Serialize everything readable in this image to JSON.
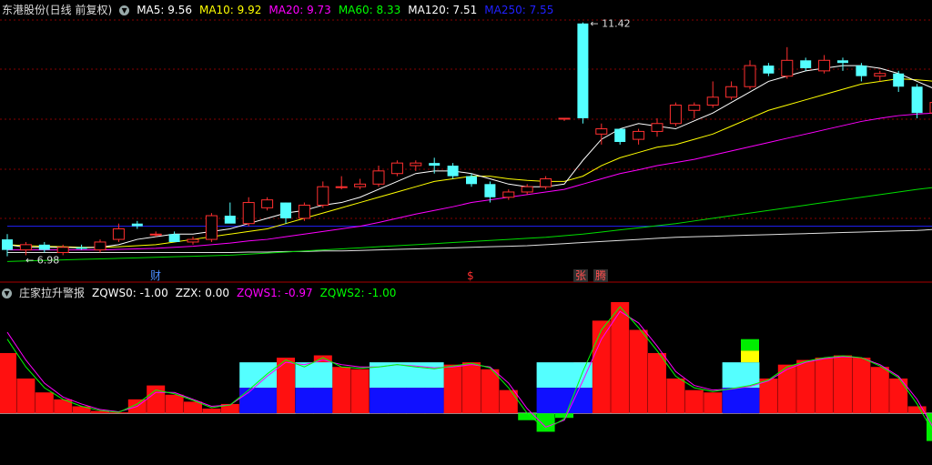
{
  "main_header": {
    "title": "东港股份(日线 前复权)",
    "ma_items": [
      {
        "label": "MA5: 9.56",
        "color": "#ffffff"
      },
      {
        "label": "MA10: 9.92",
        "color": "#ffff00"
      },
      {
        "label": "MA20: 9.73",
        "color": "#ff00ff"
      },
      {
        "label": "MA60: 8.33",
        "color": "#00ff00"
      },
      {
        "label": "MA120: 7.51",
        "color": "#ffffff"
      },
      {
        "label": "MA250: 7.55",
        "color": "#2020ff"
      }
    ]
  },
  "indicator_header": {
    "title": "庄家拉升警报",
    "items": [
      {
        "label": "ZQWS0: -1.00",
        "color": "#ffffff"
      },
      {
        "label": "ZZX: 0.00",
        "color": "#ffffff"
      },
      {
        "label": "ZQWS1: -0.97",
        "color": "#ff00ff"
      },
      {
        "label": "ZQWS2: -1.00",
        "color": "#00ff00"
      }
    ]
  },
  "price_labels": {
    "high": "11.42",
    "low": "6.98"
  },
  "events": [
    {
      "text": "财",
      "color": "#4a8cff",
      "bg": "#000000"
    },
    {
      "text": "$",
      "color": "#ff3030",
      "bg": "#000000"
    },
    {
      "text": "张",
      "color": "#ff5050",
      "bg": "#303030"
    },
    {
      "text": "腾",
      "color": "#ff5050",
      "bg": "#303030"
    }
  ],
  "colors": {
    "up": "#ff3030",
    "down": "#54ffff",
    "grid": "#880000",
    "ma250": "#2020ff"
  },
  "chart_data": {
    "type": "candlestick",
    "y_range": [
      6.8,
      11.5
    ],
    "candles": [
      {
        "o": 7.3,
        "h": 7.4,
        "l": 6.98,
        "c": 7.1
      },
      {
        "o": 7.1,
        "h": 7.25,
        "l": 7.0,
        "c": 7.2
      },
      {
        "o": 7.2,
        "h": 7.25,
        "l": 7.05,
        "c": 7.1
      },
      {
        "o": 7.05,
        "h": 7.2,
        "l": 7.0,
        "c": 7.15
      },
      {
        "o": 7.15,
        "h": 7.2,
        "l": 7.1,
        "c": 7.12
      },
      {
        "o": 7.1,
        "h": 7.3,
        "l": 7.05,
        "c": 7.25
      },
      {
        "o": 7.3,
        "h": 7.6,
        "l": 7.25,
        "c": 7.5
      },
      {
        "o": 7.6,
        "h": 7.65,
        "l": 7.5,
        "c": 7.55
      },
      {
        "o": 7.4,
        "h": 7.45,
        "l": 7.35,
        "c": 7.4
      },
      {
        "o": 7.4,
        "h": 7.45,
        "l": 7.3,
        "c": 7.25
      },
      {
        "o": 7.25,
        "h": 7.35,
        "l": 7.2,
        "c": 7.3
      },
      {
        "o": 7.3,
        "h": 7.8,
        "l": 7.25,
        "c": 7.75
      },
      {
        "o": 7.75,
        "h": 8.0,
        "l": 7.7,
        "c": 7.6
      },
      {
        "o": 7.6,
        "h": 8.1,
        "l": 7.55,
        "c": 8.0
      },
      {
        "o": 7.9,
        "h": 8.1,
        "l": 7.85,
        "c": 8.05
      },
      {
        "o": 8.0,
        "h": 8.0,
        "l": 7.6,
        "c": 7.7
      },
      {
        "o": 7.7,
        "h": 8.0,
        "l": 7.65,
        "c": 7.95
      },
      {
        "o": 7.95,
        "h": 8.4,
        "l": 7.9,
        "c": 8.3
      },
      {
        "o": 8.3,
        "h": 8.5,
        "l": 8.25,
        "c": 8.3
      },
      {
        "o": 8.3,
        "h": 8.45,
        "l": 8.25,
        "c": 8.35
      },
      {
        "o": 8.35,
        "h": 8.7,
        "l": 8.3,
        "c": 8.6
      },
      {
        "o": 8.55,
        "h": 8.8,
        "l": 8.5,
        "c": 8.75
      },
      {
        "o": 8.7,
        "h": 8.8,
        "l": 8.6,
        "c": 8.75
      },
      {
        "o": 8.75,
        "h": 8.85,
        "l": 8.55,
        "c": 8.7
      },
      {
        "o": 8.7,
        "h": 8.75,
        "l": 8.45,
        "c": 8.5
      },
      {
        "o": 8.5,
        "h": 8.55,
        "l": 8.3,
        "c": 8.35
      },
      {
        "o": 8.35,
        "h": 8.4,
        "l": 8.0,
        "c": 8.1
      },
      {
        "o": 8.1,
        "h": 8.25,
        "l": 8.05,
        "c": 8.2
      },
      {
        "o": 8.2,
        "h": 8.35,
        "l": 8.15,
        "c": 8.3
      },
      {
        "o": 8.3,
        "h": 8.5,
        "l": 8.25,
        "c": 8.45
      },
      {
        "o": 9.6,
        "h": 9.6,
        "l": 9.55,
        "c": 9.6
      },
      {
        "o": 11.4,
        "h": 11.42,
        "l": 9.5,
        "c": 9.6
      },
      {
        "o": 9.3,
        "h": 9.5,
        "l": 9.1,
        "c": 9.4
      },
      {
        "o": 9.4,
        "h": 9.4,
        "l": 9.1,
        "c": 9.15
      },
      {
        "o": 9.2,
        "h": 9.4,
        "l": 9.1,
        "c": 9.35
      },
      {
        "o": 9.35,
        "h": 9.6,
        "l": 9.25,
        "c": 9.5
      },
      {
        "o": 9.5,
        "h": 9.9,
        "l": 9.45,
        "c": 9.85
      },
      {
        "o": 9.75,
        "h": 9.9,
        "l": 9.6,
        "c": 9.85
      },
      {
        "o": 9.85,
        "h": 10.3,
        "l": 9.8,
        "c": 10.0
      },
      {
        "o": 10.0,
        "h": 10.3,
        "l": 9.95,
        "c": 10.2
      },
      {
        "o": 10.2,
        "h": 10.7,
        "l": 10.15,
        "c": 10.6
      },
      {
        "o": 10.6,
        "h": 10.65,
        "l": 10.4,
        "c": 10.45
      },
      {
        "o": 10.4,
        "h": 10.95,
        "l": 10.35,
        "c": 10.7
      },
      {
        "o": 10.7,
        "h": 10.75,
        "l": 10.5,
        "c": 10.55
      },
      {
        "o": 10.5,
        "h": 10.8,
        "l": 10.45,
        "c": 10.7
      },
      {
        "o": 10.7,
        "h": 10.75,
        "l": 10.5,
        "c": 10.65
      },
      {
        "o": 10.6,
        "h": 10.65,
        "l": 10.3,
        "c": 10.4
      },
      {
        "o": 10.4,
        "h": 10.5,
        "l": 10.3,
        "c": 10.45
      },
      {
        "o": 10.45,
        "h": 10.5,
        "l": 10.1,
        "c": 10.2
      },
      {
        "o": 10.2,
        "h": 10.25,
        "l": 9.6,
        "c": 9.7
      },
      {
        "o": 9.7,
        "h": 10.0,
        "l": 9.5,
        "c": 9.9
      },
      {
        "o": 9.85,
        "h": 10.05,
        "l": 9.8,
        "c": 9.98
      }
    ],
    "ma5": [
      7.2,
      7.15,
      7.15,
      7.15,
      7.14,
      7.15,
      7.2,
      7.3,
      7.35,
      7.4,
      7.4,
      7.45,
      7.5,
      7.6,
      7.7,
      7.8,
      7.85,
      7.95,
      8.0,
      8.1,
      8.25,
      8.4,
      8.55,
      8.6,
      8.6,
      8.55,
      8.45,
      8.35,
      8.3,
      8.3,
      8.35,
      8.8,
      9.2,
      9.4,
      9.5,
      9.45,
      9.4,
      9.55,
      9.7,
      9.9,
      10.1,
      10.3,
      10.4,
      10.5,
      10.55,
      10.6,
      10.6,
      10.55,
      10.45,
      10.3,
      10.15,
      10.1
    ],
    "ma10": [
      7.2,
      7.18,
      7.17,
      7.16,
      7.15,
      7.15,
      7.16,
      7.18,
      7.2,
      7.25,
      7.3,
      7.35,
      7.4,
      7.45,
      7.5,
      7.6,
      7.7,
      7.8,
      7.9,
      8.0,
      8.1,
      8.2,
      8.3,
      8.4,
      8.45,
      8.5,
      8.5,
      8.45,
      8.42,
      8.4,
      8.4,
      8.5,
      8.7,
      8.85,
      8.95,
      9.05,
      9.1,
      9.2,
      9.3,
      9.45,
      9.6,
      9.75,
      9.85,
      9.95,
      10.05,
      10.15,
      10.25,
      10.3,
      10.35,
      10.33,
      10.3,
      10.28
    ],
    "ma20": [
      7.1,
      7.1,
      7.1,
      7.1,
      7.1,
      7.1,
      7.11,
      7.12,
      7.13,
      7.15,
      7.17,
      7.2,
      7.23,
      7.27,
      7.3,
      7.35,
      7.4,
      7.45,
      7.5,
      7.55,
      7.62,
      7.7,
      7.78,
      7.85,
      7.92,
      8.0,
      8.05,
      8.1,
      8.15,
      8.2,
      8.25,
      8.35,
      8.45,
      8.55,
      8.62,
      8.7,
      8.76,
      8.82,
      8.9,
      8.98,
      9.06,
      9.14,
      9.22,
      9.3,
      9.38,
      9.46,
      9.54,
      9.6,
      9.65,
      9.68,
      9.7,
      9.73
    ],
    "ma60": [
      6.88,
      6.89,
      6.9,
      6.91,
      6.92,
      6.93,
      6.94,
      6.95,
      6.96,
      6.97,
      6.98,
      6.99,
      7.0,
      7.02,
      7.04,
      7.06,
      7.08,
      7.1,
      7.12,
      7.14,
      7.16,
      7.18,
      7.2,
      7.22,
      7.24,
      7.26,
      7.28,
      7.3,
      7.32,
      7.34,
      7.37,
      7.4,
      7.44,
      7.48,
      7.52,
      7.56,
      7.6,
      7.65,
      7.7,
      7.75,
      7.8,
      7.85,
      7.9,
      7.95,
      8.0,
      8.05,
      8.1,
      8.15,
      8.2,
      8.25,
      8.29,
      8.33
    ],
    "ma120": [
      7.05,
      7.05,
      7.05,
      7.05,
      7.05,
      7.05,
      7.05,
      7.05,
      7.05,
      7.05,
      7.05,
      7.05,
      7.05,
      7.06,
      7.06,
      7.07,
      7.07,
      7.08,
      7.08,
      7.09,
      7.1,
      7.11,
      7.12,
      7.13,
      7.14,
      7.15,
      7.16,
      7.17,
      7.18,
      7.2,
      7.22,
      7.24,
      7.26,
      7.28,
      7.3,
      7.32,
      7.34,
      7.35,
      7.36,
      7.37,
      7.38,
      7.39,
      7.4,
      7.41,
      7.42,
      7.43,
      7.44,
      7.45,
      7.46,
      7.47,
      7.49,
      7.51
    ],
    "ma250": [
      7.55,
      7.55,
      7.55,
      7.55,
      7.55,
      7.55,
      7.55,
      7.55,
      7.55,
      7.55,
      7.55,
      7.55,
      7.55,
      7.55,
      7.55,
      7.55,
      7.55,
      7.55,
      7.55,
      7.55,
      7.55,
      7.55,
      7.55,
      7.55,
      7.55,
      7.55,
      7.55,
      7.55,
      7.55,
      7.55,
      7.55,
      7.55,
      7.55,
      7.55,
      7.55,
      7.55,
      7.55,
      7.55,
      7.55,
      7.55,
      7.55,
      7.55,
      7.55,
      7.55,
      7.55,
      7.55,
      7.55,
      7.55,
      7.55,
      7.55,
      7.55,
      7.55
    ],
    "indicator": {
      "y_range": [
        -1.0,
        2.4
      ],
      "bars": [
        1.3,
        0.75,
        0.45,
        0.3,
        0.15,
        0.05,
        0.02,
        0.3,
        0.6,
        0.4,
        0.25,
        0.1,
        0.2,
        0.6,
        0.9,
        1.2,
        0.95,
        1.25,
        1.0,
        0.95,
        1.0,
        1.05,
        1.0,
        0.95,
        1.05,
        1.1,
        0.95,
        0.5,
        -0.15,
        -0.4,
        -0.1,
        1.1,
        2.0,
        2.4,
        1.8,
        1.3,
        0.75,
        0.5,
        0.45,
        0.55,
        0.6,
        0.75,
        1.05,
        1.15,
        1.2,
        1.25,
        1.2,
        1.0,
        0.75,
        0.15,
        -0.6,
        -1.0
      ],
      "cyan_blocks": [
        [
          13,
          14
        ],
        [
          16,
          17
        ],
        [
          20,
          23
        ],
        [
          29,
          31
        ],
        [
          39,
          40
        ]
      ],
      "green_top": [
        [
          40,
          0.55
        ]
      ],
      "zqws1": [
        1.75,
        1.15,
        0.65,
        0.35,
        0.2,
        0.08,
        0.03,
        0.15,
        0.45,
        0.45,
        0.3,
        0.15,
        0.18,
        0.45,
        0.8,
        1.1,
        1.05,
        1.15,
        1.05,
        1.0,
        1.0,
        1.05,
        1.02,
        0.98,
        1.0,
        1.05,
        1.0,
        0.65,
        0.1,
        -0.3,
        -0.15,
        0.7,
        1.6,
        2.2,
        1.95,
        1.45,
        0.9,
        0.6,
        0.5,
        0.52,
        0.58,
        0.7,
        0.95,
        1.1,
        1.18,
        1.22,
        1.2,
        1.05,
        0.8,
        0.3,
        -0.4,
        -0.85
      ],
      "zqws2": [
        1.6,
        1.0,
        0.55,
        0.3,
        0.15,
        0.06,
        0.02,
        0.2,
        0.5,
        0.42,
        0.28,
        0.12,
        0.18,
        0.5,
        0.85,
        1.15,
        1.0,
        1.2,
        1.0,
        0.97,
        1.0,
        1.05,
        1.0,
        0.96,
        1.02,
        1.08,
        0.98,
        0.55,
        0.0,
        -0.35,
        -0.12,
        0.9,
        1.8,
        2.3,
        1.85,
        1.35,
        0.8,
        0.55,
        0.47,
        0.53,
        0.6,
        0.72,
        1.0,
        1.12,
        1.2,
        1.24,
        1.2,
        1.02,
        0.77,
        0.2,
        -0.5,
        -0.95
      ]
    }
  }
}
